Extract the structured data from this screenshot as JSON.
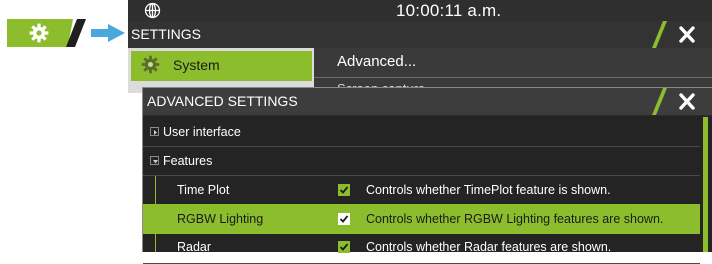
{
  "colors": {
    "accent_green": "#8cbd2c",
    "title_bar": "#333333",
    "dialog_bg": "#242424"
  },
  "status_bar": {
    "time": "10:00:11 a.m.",
    "globe_icon": "globe-icon"
  },
  "settings": {
    "title": "SETTINGS",
    "close_icon": "close-icon",
    "menu": [
      {
        "label": "System",
        "icon": "gear-icon",
        "selected": true
      }
    ],
    "right_items": [
      {
        "label": "Advanced...",
        "selected": true
      },
      {
        "label": "Screen capture",
        "partially_hidden": true
      }
    ]
  },
  "advanced": {
    "title": "ADVANCED SETTINGS",
    "close_icon": "close-icon",
    "tree": [
      {
        "label": "User interface",
        "expanded": false
      },
      {
        "label": "Features",
        "expanded": true,
        "children": [
          {
            "label": "Time Plot",
            "checked": true,
            "description": "Controls whether TimePlot feature is shown.",
            "selected": false
          },
          {
            "label": "RGBW Lighting",
            "checked": true,
            "description": "Controls whether RGBW Lighting features are shown.",
            "selected": true
          },
          {
            "label": "Radar",
            "checked": true,
            "description": "Controls whether Radar features are shown.",
            "selected": false
          }
        ]
      }
    ]
  }
}
